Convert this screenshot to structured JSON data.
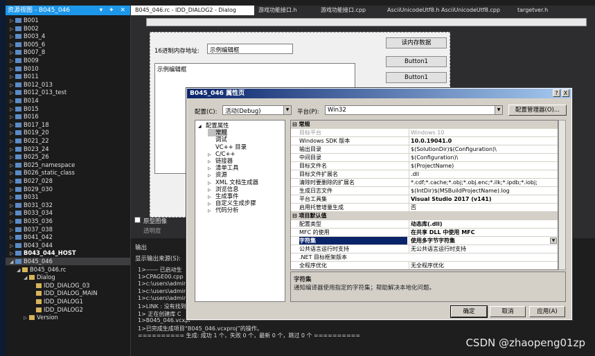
{
  "solution_explorer": {
    "title": "资源视图 - B045_046",
    "items": [
      {
        "label": "B001",
        "level": 0
      },
      {
        "label": "B002",
        "level": 0
      },
      {
        "label": "B003_4",
        "level": 0
      },
      {
        "label": "B005_6",
        "level": 0
      },
      {
        "label": "B007_8",
        "level": 0
      },
      {
        "label": "B009",
        "level": 0
      },
      {
        "label": "B010",
        "level": 0
      },
      {
        "label": "B011",
        "level": 0
      },
      {
        "label": "B012_013",
        "level": 0
      },
      {
        "label": "B012_013_test",
        "level": 0
      },
      {
        "label": "B014",
        "level": 0
      },
      {
        "label": "B015",
        "level": 0
      },
      {
        "label": "B016",
        "level": 0
      },
      {
        "label": "B017_18",
        "level": 0
      },
      {
        "label": "B019_20",
        "level": 0
      },
      {
        "label": "B021_22",
        "level": 0
      },
      {
        "label": "B023_24",
        "level": 0
      },
      {
        "label": "B025_26",
        "level": 0
      },
      {
        "label": "B025_namespace",
        "level": 0
      },
      {
        "label": "B026_static_class",
        "level": 0
      },
      {
        "label": "B027_028",
        "level": 0
      },
      {
        "label": "B029_030",
        "level": 0
      },
      {
        "label": "B031",
        "level": 0
      },
      {
        "label": "B031_032",
        "level": 0
      },
      {
        "label": "B033_034",
        "level": 0
      },
      {
        "label": "B035_036",
        "level": 0
      },
      {
        "label": "B037_038",
        "level": 0
      },
      {
        "label": "B041_042",
        "level": 0
      },
      {
        "label": "B043_044",
        "level": 0
      },
      {
        "label": "B043_044_HOST",
        "level": 0,
        "bold": true
      },
      {
        "label": "B045_046",
        "level": 0,
        "expanded": true,
        "sel": true
      },
      {
        "label": "B045_046.rc",
        "level": 1,
        "expanded": true
      },
      {
        "label": "Dialog",
        "level": 2,
        "expanded": true
      },
      {
        "label": "IDD_DIALOG_03",
        "level": 3
      },
      {
        "label": "IDD_DIALOG_MAIN",
        "level": 3
      },
      {
        "label": "IDD_DIALOG1",
        "level": 3
      },
      {
        "label": "IDD_DIALOG2",
        "level": 3
      },
      {
        "label": "Version",
        "level": 2
      }
    ]
  },
  "tabs": [
    "B045_046.rc - IDD_DIALOG2 - Dialog",
    "游戏功能接口.h",
    "游戏功能接口.cpp",
    "AsciiUnicodeUtf8.h",
    "AsciiUnicodeUtf8.cpp",
    "targetver.h"
  ],
  "designer": {
    "addr_label": "16进制内存地址:",
    "addr_value": "示例编辑框",
    "read_button": "读内存数据",
    "button1a": "Button1",
    "button1b": "Button1",
    "edit_multi": "示例编辑框",
    "prototype_label": "原型图像",
    "transparency_label": "透明度"
  },
  "output": {
    "title": "输出",
    "source_label": "显示输出来源(S):",
    "lines": [
      "1>------ 已启动生",
      "1>CPAGE00.cpp",
      "1>c:\\users\\admin",
      "1>c:\\users\\admin",
      "1>c:\\users\\admin",
      "1>LINK : 没有找到",
      "1>  正在创建库 C",
      "1>B045_046.vcxpr",
      "1>已完成生成项目“B045_046.vcxproj”的操作。",
      "========== 生成: 成功 1 个，失败 0 个，最新 0 个，跳过 0 个 =========="
    ]
  },
  "dialog": {
    "title": "B045_046 属性页",
    "help": "?",
    "close": "X",
    "config_label": "配置(C):",
    "config_value": "活动(Debug)",
    "platform_label": "平台(P):",
    "platform_value": "Win32",
    "config_manager": "配置管理器(O)...",
    "tree": [
      {
        "label": "配置属性",
        "level": 0,
        "arrow": "◢"
      },
      {
        "label": "常规",
        "level": 1,
        "sel": true
      },
      {
        "label": "调试",
        "level": 1
      },
      {
        "label": "VC++ 目录",
        "level": 1
      },
      {
        "label": "C/C++",
        "level": 1,
        "arrow": "▷"
      },
      {
        "label": "链接器",
        "level": 1,
        "arrow": "▷"
      },
      {
        "label": "清单工具",
        "level": 1,
        "arrow": "▷"
      },
      {
        "label": "资源",
        "level": 1,
        "arrow": "▷"
      },
      {
        "label": "XML 文档生成器",
        "level": 1,
        "arrow": "▷"
      },
      {
        "label": "浏览信息",
        "level": 1,
        "arrow": "▷"
      },
      {
        "label": "生成事件",
        "level": 1,
        "arrow": "▷"
      },
      {
        "label": "自定义生成步骤",
        "level": 1,
        "arrow": "▷"
      },
      {
        "label": "代码分析",
        "level": 1,
        "arrow": "▷"
      }
    ],
    "grid": [
      {
        "k": "常规",
        "cat": true
      },
      {
        "k": "目标平台",
        "v": "Windows 10",
        "gray": true
      },
      {
        "k": "Windows SDK 版本",
        "v": "10.0.19041.0",
        "bold": true
      },
      {
        "k": "输出目录",
        "v": "$(SolutionDir)$(Configuration)\\"
      },
      {
        "k": "中间目录",
        "v": "$(Configuration)\\"
      },
      {
        "k": "目标文件名",
        "v": "$(ProjectName)"
      },
      {
        "k": "目标文件扩展名",
        "v": ".dll"
      },
      {
        "k": "清除时要删除的扩展名",
        "v": "*.cdf;*.cache;*.obj;*.obj.enc;*.ilk;*.ipdb;*.iobj;"
      },
      {
        "k": "生成日志文件",
        "v": "$(IntDir)$(MSBuildProjectName).log"
      },
      {
        "k": "平台工具集",
        "v": "Visual Studio 2017 (v141)",
        "bold": true
      },
      {
        "k": "启用托管增量生成",
        "v": "否"
      },
      {
        "k": "项目默认值",
        "cat": true
      },
      {
        "k": "配置类型",
        "v": "动态库(.dll)",
        "bold": true
      },
      {
        "k": "MFC 的使用",
        "v": "在共享 DLL 中使用 MFC",
        "bold": true
      },
      {
        "k": "字符集",
        "v": "使用多字节字符集",
        "sel": true
      },
      {
        "k": "公共语言运行时支持",
        "v": "无公共语言运行时支持"
      },
      {
        "k": ".NET 目标框架版本",
        "v": ""
      },
      {
        "k": "全程序优化",
        "v": "无全程序优化"
      }
    ],
    "desc_title": "字符集",
    "desc_text": "通知编译器使用指定的字符集；帮助解决本地化问题。",
    "ok": "确定",
    "cancel": "取消",
    "apply": "应用(A)"
  },
  "watermark": "CSDN @zhaopeng01zp",
  "colors": {
    "accent": "#1c97ea",
    "dialog_title": "#0a246a",
    "selection": "#0a246a"
  }
}
